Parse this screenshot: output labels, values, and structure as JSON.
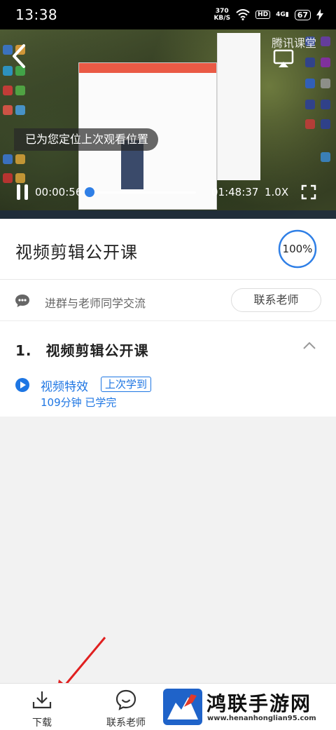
{
  "status_bar": {
    "time": "13:38",
    "net_speed_value": "370",
    "net_speed_unit": "KB/S",
    "hd_label": "HD",
    "signal_label": "4G",
    "battery": "67"
  },
  "player": {
    "brand": "腾讯课堂",
    "toast": "已为您定位上次观看位置",
    "current_time": "00:00:56",
    "total_time": "01:48:37",
    "speed": "1.0X",
    "progress_fraction": 0.009,
    "colors": {
      "accent": "#2f7fe6"
    }
  },
  "course": {
    "title": "视频剪辑公开课",
    "progress": "100%"
  },
  "group": {
    "text": "进群与老师同学交流",
    "contact_button": "联系老师"
  },
  "chapter": {
    "number": "1.",
    "title": "视频剪辑公开课",
    "lesson": {
      "name": "视频特效",
      "badge": "上次学到",
      "meta": "109分钟  已学完"
    }
  },
  "bottom_nav": {
    "download_label": "下载",
    "contact_label": "联系老师"
  },
  "watermark": {
    "title": "鸿联手游网",
    "url": "www.henanhonglian95.com"
  }
}
